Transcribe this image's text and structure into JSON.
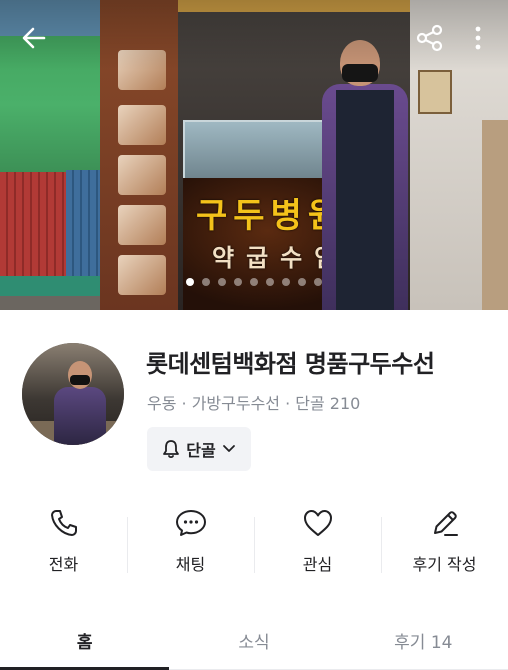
{
  "hero": {
    "sign_main": "구두병원",
    "sign_sub": "약굽수염",
    "photo_count": 9,
    "active_photo": 1
  },
  "profile": {
    "name": "롯데센텀백화점 명품구두수선",
    "meta": "우동 · 가방구두수선 · 단골 210",
    "follow_label": "단골"
  },
  "actions": [
    {
      "icon": "phone-icon",
      "label": "전화"
    },
    {
      "icon": "chat-icon",
      "label": "채팅"
    },
    {
      "icon": "heart-icon",
      "label": "관심"
    },
    {
      "icon": "pencil-icon",
      "label": "후기 작성"
    }
  ],
  "tabs": [
    {
      "label": "홈",
      "active": true
    },
    {
      "label": "소식",
      "active": false
    },
    {
      "label": "후기 14",
      "active": false
    }
  ]
}
